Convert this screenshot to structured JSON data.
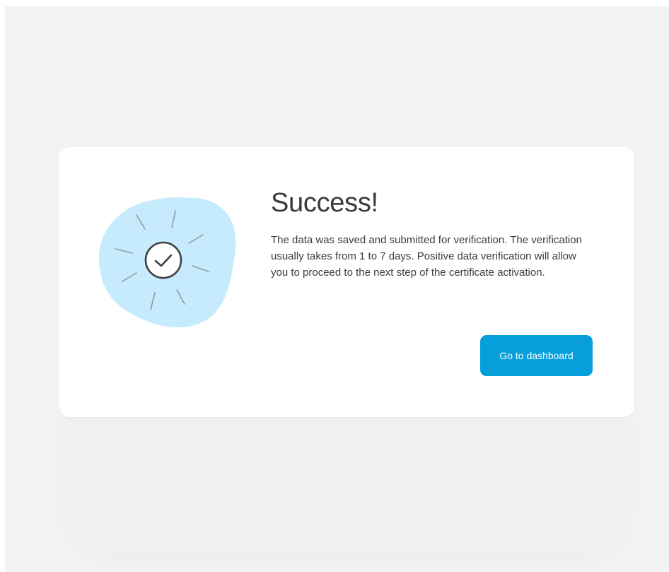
{
  "dialog": {
    "title": "Success!",
    "message": "The data was saved and submitted for verification. The verification usually takes from 1 to 7 days. Positive data verification will allow you to proceed to the next step of the certificate activation.",
    "button_label": "Go to dashboard",
    "illustration_icon": "check-circle-icon"
  },
  "colors": {
    "page_background": "#f3f3f3",
    "card_background": "#ffffff",
    "accent": "#069fdc",
    "blob": "#c6ebfc",
    "text": "#3a3a3a"
  }
}
